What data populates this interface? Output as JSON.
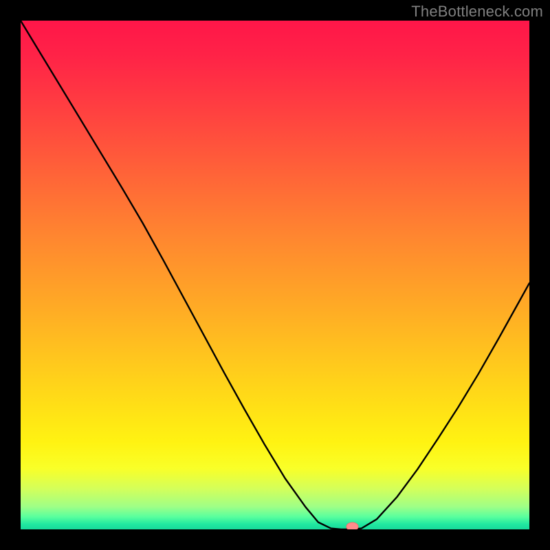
{
  "attribution": "TheBottleneck.com",
  "palette": {
    "gradient_stops": [
      {
        "offset": 0.0,
        "color": "#ff1649"
      },
      {
        "offset": 0.07,
        "color": "#ff2347"
      },
      {
        "offset": 0.18,
        "color": "#ff4140"
      },
      {
        "offset": 0.3,
        "color": "#ff6338"
      },
      {
        "offset": 0.42,
        "color": "#ff8530"
      },
      {
        "offset": 0.55,
        "color": "#ffa726"
      },
      {
        "offset": 0.66,
        "color": "#ffc51e"
      },
      {
        "offset": 0.76,
        "color": "#ffe016"
      },
      {
        "offset": 0.83,
        "color": "#fff312"
      },
      {
        "offset": 0.88,
        "color": "#f9ff28"
      },
      {
        "offset": 0.92,
        "color": "#d4ff5a"
      },
      {
        "offset": 0.955,
        "color": "#a0ff86"
      },
      {
        "offset": 0.975,
        "color": "#5aff9e"
      },
      {
        "offset": 0.99,
        "color": "#20e8a0"
      },
      {
        "offset": 1.0,
        "color": "#18d99b"
      }
    ],
    "curve_stroke": "#000000",
    "marker_fill": "#ff8c8c",
    "marker_stroke": "#ff6b6b"
  },
  "chart_data": {
    "type": "line",
    "title": "",
    "xlabel": "",
    "ylabel": "",
    "xlim": [
      0,
      100
    ],
    "ylim": [
      0,
      100
    ],
    "x": [
      0,
      4,
      8,
      12,
      16,
      20,
      24,
      28,
      32,
      36,
      40,
      44,
      48,
      52,
      56,
      58.5,
      61,
      63,
      65,
      67,
      70,
      74,
      78,
      82,
      86,
      90,
      94,
      98,
      100
    ],
    "values": [
      100,
      93.4,
      86.8,
      80.2,
      73.6,
      67.0,
      60.2,
      53.0,
      45.6,
      38.2,
      30.8,
      23.6,
      16.6,
      10.0,
      4.4,
      1.4,
      0.2,
      0.0,
      0.0,
      0.2,
      2.0,
      6.4,
      11.8,
      17.8,
      24.0,
      30.6,
      37.6,
      44.8,
      48.4
    ],
    "marker": {
      "x": 65.2,
      "y": 0.0
    },
    "annotations": []
  }
}
